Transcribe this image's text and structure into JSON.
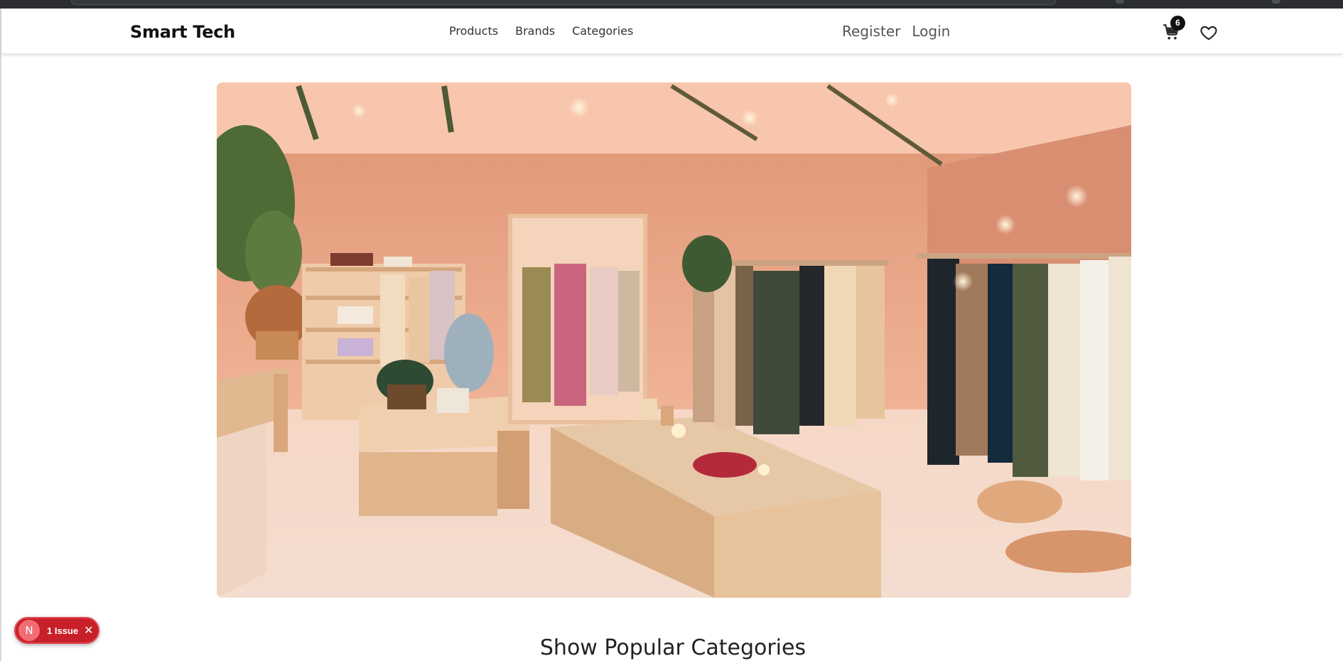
{
  "header": {
    "logo": "Smart Tech",
    "nav": [
      "Products",
      "Brands",
      "Categories"
    ],
    "auth": [
      "Register",
      "Login"
    ],
    "cart_count": "6"
  },
  "hero": {
    "icon": "clothing-store-photo"
  },
  "main": {
    "section_title": "Show Popular Categories"
  },
  "dev_overlay": {
    "badge_letter": "N",
    "issues_label": "1 Issue",
    "close_glyph": "✕"
  },
  "colors": {
    "badge_red": "#c8202a",
    "text_dark": "#222222"
  }
}
